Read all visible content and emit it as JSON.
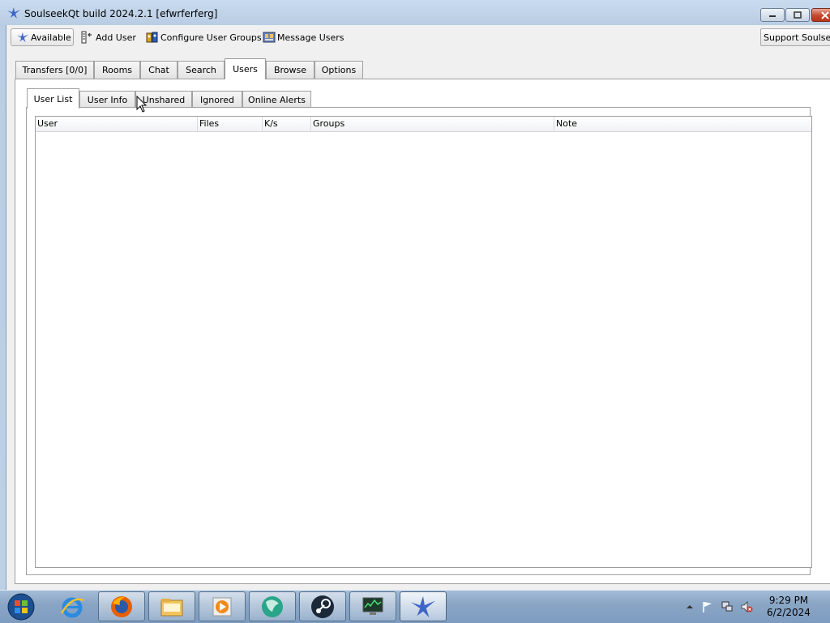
{
  "window": {
    "title": "SoulseekQt build 2024.2.1 [efwrferferg]"
  },
  "toolbar": {
    "status_label": "Available",
    "add_user_label": "Add User",
    "configure_groups_label": "Configure User Groups",
    "message_users_label": "Message Users",
    "support_label": "Support Soulseek"
  },
  "main_tabs": [
    {
      "label": "Transfers [0/0]",
      "active": false
    },
    {
      "label": "Rooms",
      "active": false
    },
    {
      "label": "Chat",
      "active": false
    },
    {
      "label": "Search",
      "active": false
    },
    {
      "label": "Users",
      "active": true
    },
    {
      "label": "Browse",
      "active": false
    },
    {
      "label": "Options",
      "active": false
    }
  ],
  "sub_tabs": [
    {
      "label": "User List",
      "active": true
    },
    {
      "label": "User Info",
      "active": false
    },
    {
      "label": "Unshared",
      "active": false
    },
    {
      "label": "Ignored",
      "active": false
    },
    {
      "label": "Online Alerts",
      "active": false
    }
  ],
  "table": {
    "columns": [
      "User",
      "Files",
      "K/s",
      "Groups",
      "Note"
    ],
    "rows": []
  },
  "taskbar": {
    "apps": [
      "internet-explorer",
      "firefox",
      "file-explorer",
      "media-player",
      "app-globe",
      "steam",
      "task-manager",
      "soulseek"
    ],
    "clock_time": "9:29 PM",
    "clock_date": "6/2/2024"
  },
  "colors": {
    "title_bar": "#bcd0e6",
    "close_button": "#c7462c",
    "taskbar": "#8aa6c6"
  }
}
